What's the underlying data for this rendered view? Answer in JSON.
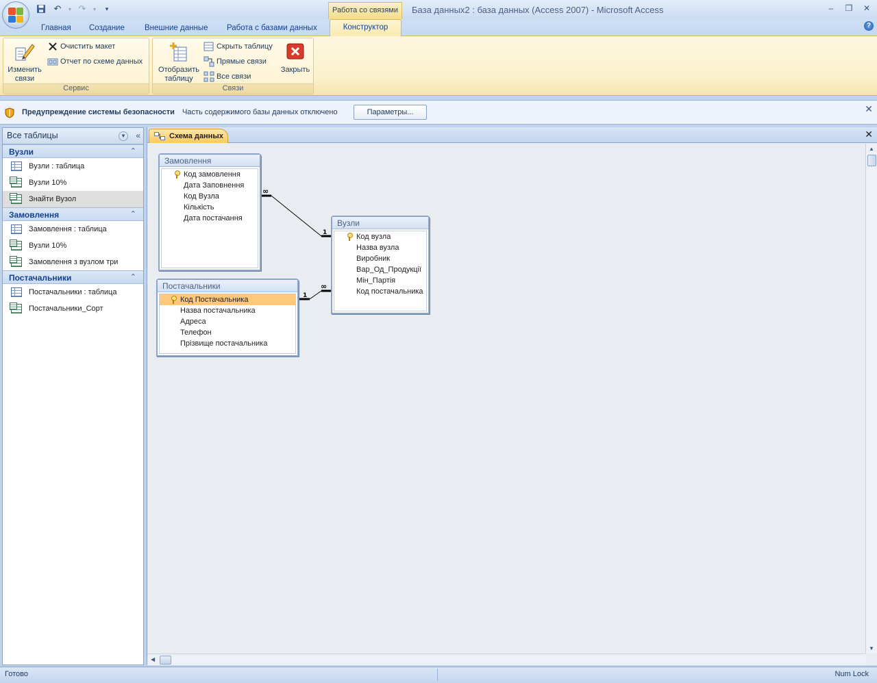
{
  "titlebar": {
    "context_tab_header": "Работа со связями",
    "window_title": "База данных2 : база данных (Access 2007)  -  Microsoft Access"
  },
  "ribbon": {
    "tabs": [
      "Главная",
      "Создание",
      "Внешние данные",
      "Работа с базами данных"
    ],
    "active_tab": "Конструктор",
    "groups": {
      "service": {
        "label": "Сервис",
        "edit_relationships": "Изменить связи",
        "clear_layout": "Очистить макет",
        "relationship_report": "Отчет по схеме данных"
      },
      "relationships": {
        "label": "Связи",
        "show_table": "Отобразить таблицу",
        "hide_table": "Скрыть таблицу",
        "direct_relationships": "Прямые связи",
        "all_relationships": "Все связи",
        "close": "Закрыть"
      }
    }
  },
  "message_bar": {
    "title": "Предупреждение системы безопасности",
    "text": "Часть содержимого базы данных отключено",
    "options_button": "Параметры..."
  },
  "nav_pane": {
    "title": "Все таблицы",
    "groups": [
      {
        "title": "Вузли",
        "items": [
          {
            "label": "Вузли : таблица",
            "icon": "table-icon"
          },
          {
            "label": "Вузли 10%",
            "icon": "query-icon"
          },
          {
            "label": "Знайти Вузол",
            "icon": "query-icon",
            "selected": true
          }
        ]
      },
      {
        "title": "Замовлення",
        "items": [
          {
            "label": "Замовлення : таблица",
            "icon": "table-icon"
          },
          {
            "label": "Вузли 10%",
            "icon": "query-icon"
          },
          {
            "label": "Замовлення з вузлом три",
            "icon": "query-icon"
          }
        ]
      },
      {
        "title": "Постачальники",
        "items": [
          {
            "label": "Постачальники : таблица",
            "icon": "table-icon"
          },
          {
            "label": "Постачальники_Сорт",
            "icon": "query-icon"
          }
        ]
      }
    ]
  },
  "document": {
    "tab_label": "Схема данных",
    "tables": [
      {
        "title": "Замовлення",
        "fields": [
          {
            "name": "Код замовлення",
            "key": true
          },
          {
            "name": "Дата Заповнення"
          },
          {
            "name": "Код Вузла"
          },
          {
            "name": "Кількість"
          },
          {
            "name": "Дата постачання"
          }
        ]
      },
      {
        "title": "Вузли",
        "fields": [
          {
            "name": "Код вузла",
            "key": true
          },
          {
            "name": "Назва вузла"
          },
          {
            "name": "Виробник"
          },
          {
            "name": "Вар_Од_Продукції"
          },
          {
            "name": "Мін_Партія"
          },
          {
            "name": "Код постачальника"
          }
        ]
      },
      {
        "title": "Постачальники",
        "fields": [
          {
            "name": "Код Постачальника",
            "key": true,
            "selected": true
          },
          {
            "name": "Назва постачальника"
          },
          {
            "name": "Адреса"
          },
          {
            "name": "Телефон"
          },
          {
            "name": "Прізвище постачальника"
          }
        ]
      }
    ],
    "relationships": [
      {
        "from_table": "Замовлення",
        "from_side": "∞",
        "to_table": "Вузли",
        "to_side": "1"
      },
      {
        "from_table": "Постачальники",
        "from_side": "1",
        "to_table": "Вузли",
        "to_side": "∞"
      }
    ]
  },
  "status_bar": {
    "status": "Готово",
    "num_lock": "Num Lock"
  }
}
